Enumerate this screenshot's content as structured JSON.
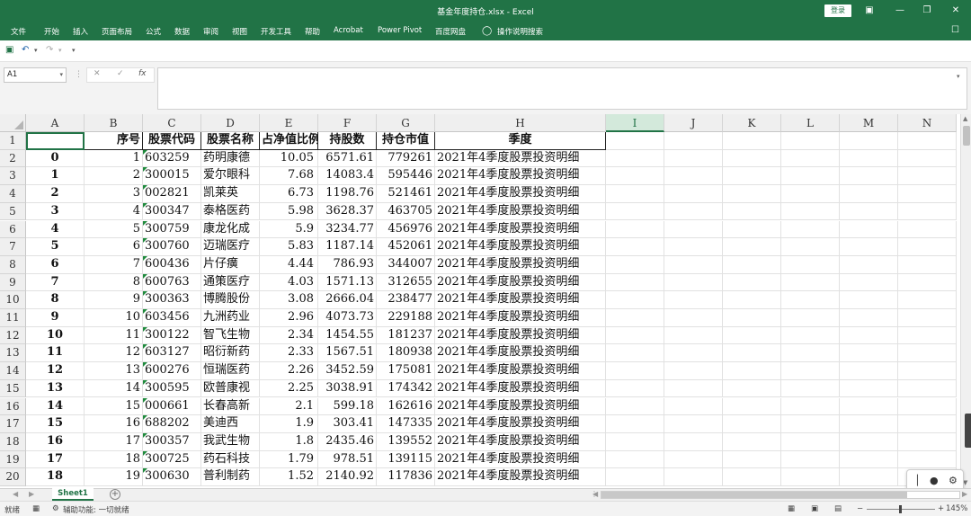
{
  "window": {
    "title": "基金年度持仓.xlsx - Excel",
    "login_label": "登录",
    "ribbon_display_icon": "ribbon-display-icon",
    "minimize_glyph": "—",
    "restore_glyph": "❐",
    "close_glyph": "✕"
  },
  "menu": {
    "tabs": [
      "文件",
      "开始",
      "插入",
      "页面布局",
      "公式",
      "数据",
      "审阅",
      "视图",
      "开发工具",
      "帮助",
      "Acrobat",
      "Power Pivot",
      "百度网盘",
      "操作说明搜索"
    ],
    "search_icon": "lightbulb-icon",
    "comment_icon": "comment-icon"
  },
  "qat": {
    "save_icon": "save-icon",
    "undo_icon": "undo-icon",
    "redo_icon": "redo-icon",
    "customize_icon": "customize-icon"
  },
  "formula_bar": {
    "name_box": "A1",
    "cancel_glyph": "✕",
    "enter_glyph": "✓",
    "fx_label": "fx",
    "content": ""
  },
  "grid": {
    "columns": [
      "A",
      "B",
      "C",
      "D",
      "E",
      "F",
      "G",
      "H",
      "I",
      "J",
      "K",
      "L",
      "M",
      "N"
    ],
    "selected_column": "I",
    "row_numbers": [
      "1",
      "2",
      "3",
      "4",
      "5",
      "6",
      "7",
      "8",
      "9",
      "10",
      "11",
      "12",
      "13",
      "14",
      "15",
      "16",
      "17",
      "18",
      "19",
      "20"
    ],
    "header_row": [
      "",
      "序号",
      "股票代码",
      "股票名称",
      "占净值比例",
      "持股数",
      "持仓市值",
      "季度"
    ],
    "rows": [
      [
        "0",
        "1",
        "603259",
        "药明康德",
        "10.05",
        "6571.61",
        "779261",
        "2021年4季度股票投资明细"
      ],
      [
        "1",
        "2",
        "300015",
        "爱尔眼科",
        "7.68",
        "14083.4",
        "595446",
        "2021年4季度股票投资明细"
      ],
      [
        "2",
        "3",
        "002821",
        "凯莱英",
        "6.73",
        "1198.76",
        "521461",
        "2021年4季度股票投资明细"
      ],
      [
        "3",
        "4",
        "300347",
        "泰格医药",
        "5.98",
        "3628.37",
        "463705",
        "2021年4季度股票投资明细"
      ],
      [
        "4",
        "5",
        "300759",
        "康龙化成",
        "5.9",
        "3234.77",
        "456976",
        "2021年4季度股票投资明细"
      ],
      [
        "5",
        "6",
        "300760",
        "迈瑞医疗",
        "5.83",
        "1187.14",
        "452061",
        "2021年4季度股票投资明细"
      ],
      [
        "6",
        "7",
        "600436",
        "片仔癀",
        "4.44",
        "786.93",
        "344007",
        "2021年4季度股票投资明细"
      ],
      [
        "7",
        "8",
        "600763",
        "通策医疗",
        "4.03",
        "1571.13",
        "312655",
        "2021年4季度股票投资明细"
      ],
      [
        "8",
        "9",
        "300363",
        "博腾股份",
        "3.08",
        "2666.04",
        "238477",
        "2021年4季度股票投资明细"
      ],
      [
        "9",
        "10",
        "603456",
        "九洲药业",
        "2.96",
        "4073.73",
        "229188",
        "2021年4季度股票投资明细"
      ],
      [
        "10",
        "11",
        "300122",
        "智飞生物",
        "2.34",
        "1454.55",
        "181237",
        "2021年4季度股票投资明细"
      ],
      [
        "11",
        "12",
        "603127",
        "昭衍新药",
        "2.33",
        "1567.51",
        "180938",
        "2021年4季度股票投资明细"
      ],
      [
        "12",
        "13",
        "600276",
        "恒瑞医药",
        "2.26",
        "3452.59",
        "175081",
        "2021年4季度股票投资明细"
      ],
      [
        "13",
        "14",
        "300595",
        "欧普康视",
        "2.25",
        "3038.91",
        "174342",
        "2021年4季度股票投资明细"
      ],
      [
        "14",
        "15",
        "000661",
        "长春高新",
        "2.1",
        "599.18",
        "162616",
        "2021年4季度股票投资明细"
      ],
      [
        "15",
        "16",
        "688202",
        "美迪西",
        "1.9",
        "303.41",
        "147335",
        "2021年4季度股票投资明细"
      ],
      [
        "16",
        "17",
        "300357",
        "我武生物",
        "1.8",
        "2435.46",
        "139552",
        "2021年4季度股票投资明细"
      ],
      [
        "17",
        "18",
        "300725",
        "药石科技",
        "1.79",
        "978.51",
        "139115",
        "2021年4季度股票投资明细"
      ],
      [
        "18",
        "19",
        "300630",
        "普利制药",
        "1.52",
        "2140.92",
        "117836",
        "2021年4季度股票投资明细"
      ]
    ]
  },
  "sheets": {
    "active": "Sheet1",
    "add_icon": "plus-icon"
  },
  "status": {
    "ready": "就绪",
    "accessibility": "辅助功能: 一切就绪",
    "zoom": "145%",
    "zoom_out": "−",
    "zoom_in": "+"
  }
}
